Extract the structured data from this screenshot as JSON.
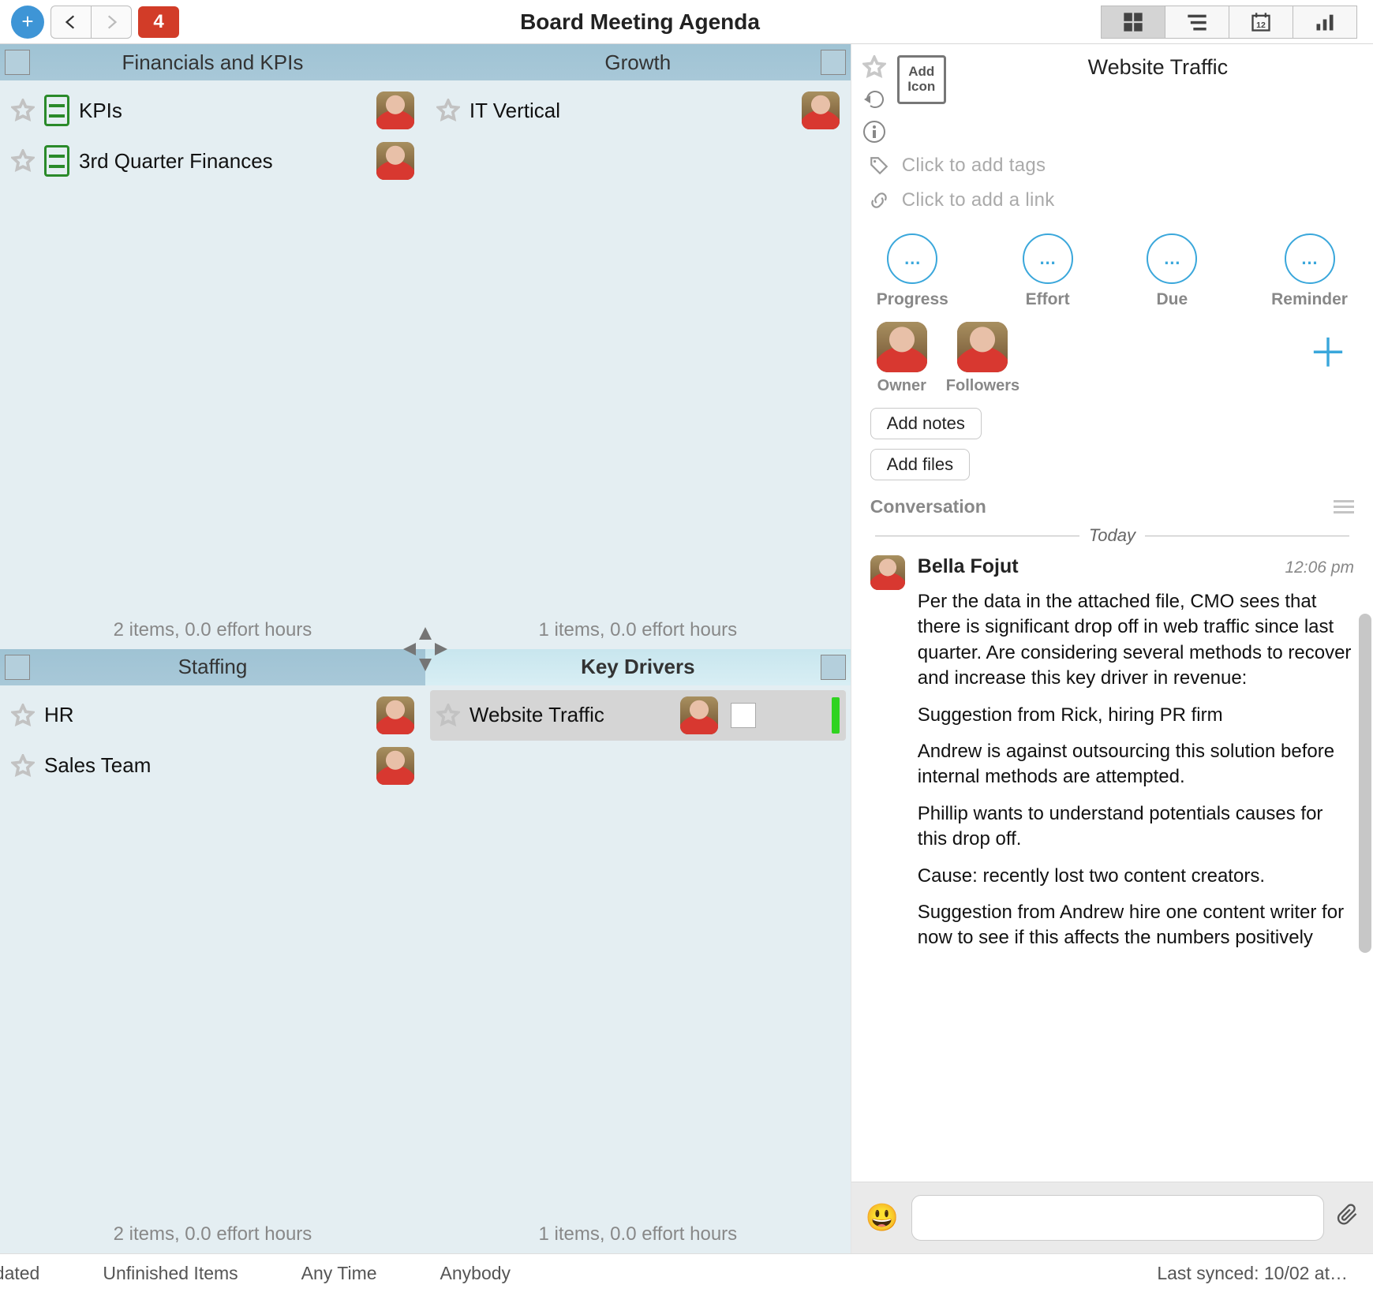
{
  "header": {
    "title": "Board Meeting Agenda",
    "notification_count": "4"
  },
  "quadrants": [
    {
      "title": "Financials and KPIs",
      "footer": "2 items, 0.0 effort hours",
      "cards": [
        {
          "title": "KPIs",
          "icon": "task"
        },
        {
          "title": "3rd Quarter Finances",
          "icon": "task"
        }
      ]
    },
    {
      "title": "Growth",
      "footer": "1 items, 0.0 effort hours",
      "cards": [
        {
          "title": "IT Vertical",
          "icon": "none"
        }
      ]
    },
    {
      "title": "Staffing",
      "footer": "2 items, 0.0 effort hours",
      "cards": [
        {
          "title": "HR",
          "icon": "none"
        },
        {
          "title": "Sales Team",
          "icon": "none"
        }
      ]
    },
    {
      "title": "Key Drivers",
      "footer": "1 items, 0.0 effort hours",
      "cards": [
        {
          "title": "Website Traffic",
          "icon": "none",
          "selected": true
        }
      ]
    }
  ],
  "detail": {
    "title": "Website Traffic",
    "add_icon_label": "Add Icon",
    "tags_placeholder": "Click to add tags",
    "link_placeholder": "Click to add a link",
    "props": {
      "progress": "Progress",
      "effort": "Effort",
      "due": "Due",
      "reminder": "Reminder"
    },
    "people": {
      "owner": "Owner",
      "followers": "Followers"
    },
    "add_notes": "Add notes",
    "add_files": "Add files",
    "conversation_label": "Conversation",
    "today_label": "Today",
    "message": {
      "author": "Bella Fojut",
      "time": "12:06 pm",
      "paragraphs": [
        "Per the data in the attached file, CMO sees that there is significant drop off in web traffic since last quarter. Are considering several methods to recover and increase this key driver in revenue:",
        "Suggestion from Rick, hiring PR firm",
        "Andrew is against outsourcing this solution before internal methods are attempted.",
        "Phillip wants to understand potentials causes for this drop off.",
        "Cause: recently lost two content creators.",
        "Suggestion from Andrew hire one content writer for now to see if this affects the numbers positively"
      ]
    }
  },
  "status": {
    "updated": "pdated",
    "unfinished": "Unfinished Items",
    "anytime": "Any Time",
    "anybody": "Anybody",
    "last_synced": "Last synced: 10/02 at…"
  }
}
